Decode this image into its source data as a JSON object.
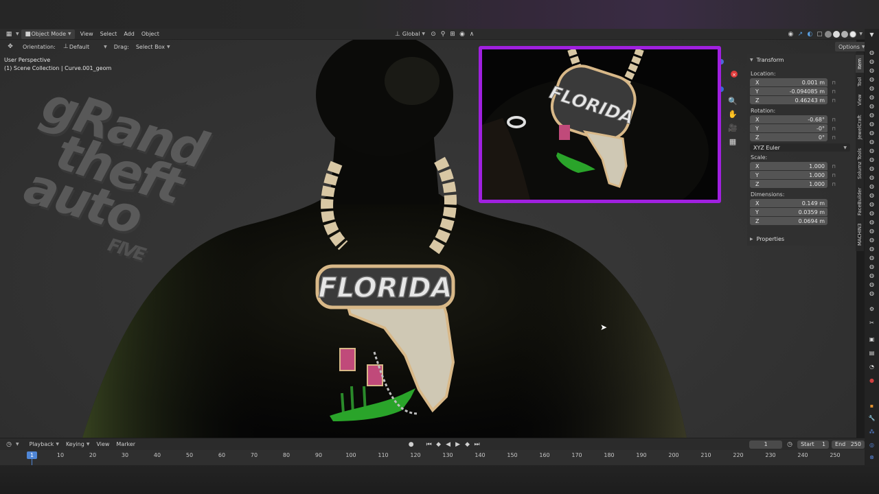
{
  "header": {
    "mode": "Object Mode",
    "menus": [
      "View",
      "Select",
      "Add",
      "Object"
    ],
    "orientation_global": "Global"
  },
  "toolrow": {
    "orientation_label": "Orientation:",
    "orientation_value": "Default",
    "drag_label": "Drag:",
    "drag_value": "Select Box",
    "options": "Options"
  },
  "viewport": {
    "perspective": "User Perspective",
    "collection": "(1) Scene Collection | Curve.001_geom"
  },
  "overlay_logo": {
    "line1": "gRand",
    "line2": "theft",
    "line3": "auto",
    "line4": "FIVE"
  },
  "pendant": {
    "text": "FLORIDA"
  },
  "npanel": {
    "section": "Transform",
    "location_label": "Location:",
    "location": [
      {
        "axis": "X",
        "value": "0.001 m"
      },
      {
        "axis": "Y",
        "value": "-0.094085 m"
      },
      {
        "axis": "Z",
        "value": "0.46243 m"
      }
    ],
    "rotation_label": "Rotation:",
    "rotation": [
      {
        "axis": "X",
        "value": "-0.68°"
      },
      {
        "axis": "Y",
        "value": "-0°"
      },
      {
        "axis": "Z",
        "value": "0°"
      }
    ],
    "rotation_mode": "XYZ Euler",
    "scale_label": "Scale:",
    "scale": [
      {
        "axis": "X",
        "value": "1.000"
      },
      {
        "axis": "Y",
        "value": "1.000"
      },
      {
        "axis": "Z",
        "value": "1.000"
      }
    ],
    "dimensions_label": "Dimensions:",
    "dimensions": [
      {
        "axis": "X",
        "value": "0.149 m"
      },
      {
        "axis": "Y",
        "value": "0.0359 m"
      },
      {
        "axis": "Z",
        "value": "0.0694 m"
      }
    ],
    "properties": "Properties"
  },
  "tabs": [
    "Item",
    "Tool",
    "View",
    "JewelCraft",
    "Solumz Tools",
    "FaceBuilder",
    "MACHIN3"
  ],
  "timeline": {
    "menus": [
      "Playback",
      "Keying",
      "View",
      "Marker"
    ],
    "current_frame": "1",
    "start_label": "Start",
    "start": "1",
    "end_label": "End",
    "end": "250",
    "ticks": [
      "10",
      "20",
      "30",
      "40",
      "50",
      "60",
      "70",
      "80",
      "90",
      "100",
      "110",
      "120",
      "130",
      "140",
      "150",
      "160",
      "170",
      "180",
      "190",
      "200",
      "210",
      "220",
      "230",
      "240",
      "250"
    ]
  },
  "colors": {
    "inset_border": "#a020e0",
    "accent": "#4f86d6",
    "gizmo_x": "#e03a3a"
  }
}
